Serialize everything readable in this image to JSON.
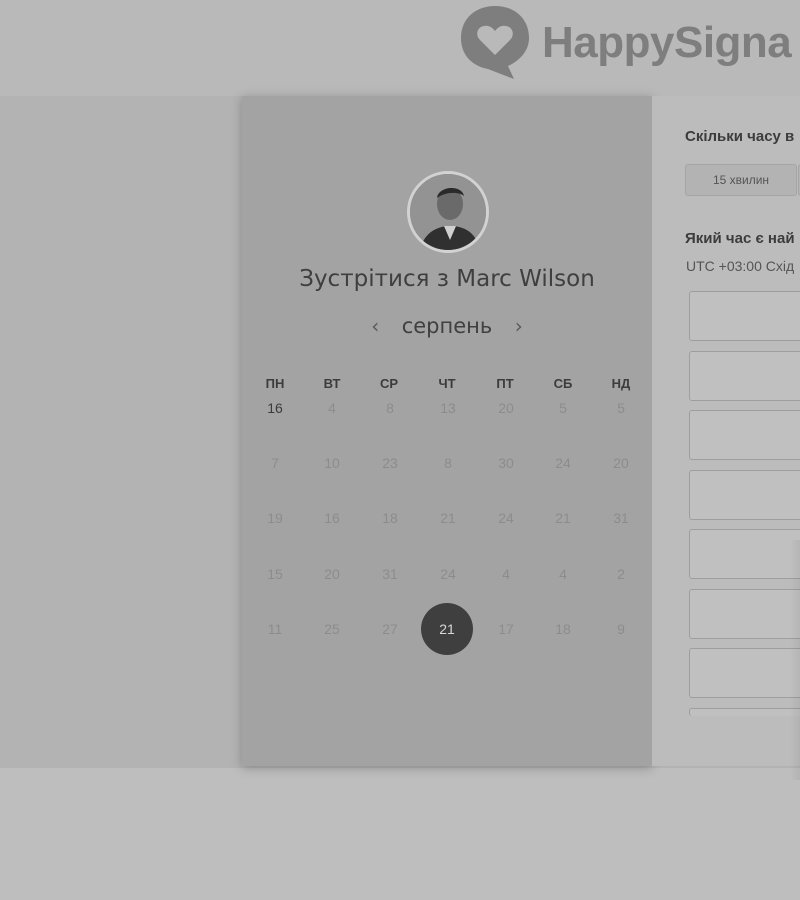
{
  "header": {
    "brand": "HappySigna",
    "logo_icon": "heart-speech-bubble-icon"
  },
  "left_panel": {
    "title": "Зустрітися з Marc Wilson",
    "month": "серпень",
    "prev_icon": "chevron-left-icon",
    "next_icon": "chevron-right-icon",
    "weekdays": [
      "ПН",
      "ВТ",
      "СР",
      "ЧТ",
      "ПТ",
      "СБ",
      "НД"
    ],
    "weeks": [
      [
        "16",
        "4",
        "8",
        "13",
        "20",
        "5",
        "5"
      ],
      [
        "7",
        "10",
        "23",
        "8",
        "30",
        "24",
        "20"
      ],
      [
        "19",
        "16",
        "18",
        "21",
        "24",
        "21",
        "31"
      ],
      [
        "15",
        "20",
        "31",
        "24",
        "4",
        "4",
        "2"
      ],
      [
        "11",
        "25",
        "27",
        "21",
        "17",
        "18",
        "9"
      ]
    ],
    "active_day": "16",
    "selected_day": "21"
  },
  "right_panel": {
    "duration_question": "Скільки часу в",
    "duration_option": "15 хвилин",
    "time_question": "Який час є най",
    "timezone": "UTC +03:00 Схід"
  },
  "colors": {
    "left_card_bg": "#a3a3a3",
    "selected_day_bg": "#3f3f3f",
    "page_bg": "#b9b9b9"
  }
}
